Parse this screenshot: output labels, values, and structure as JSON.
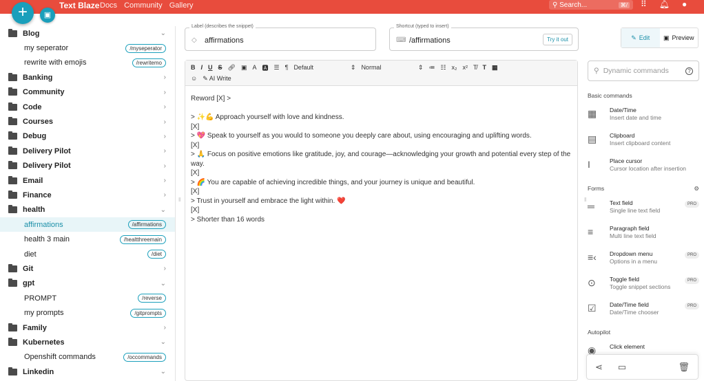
{
  "topbar": {
    "brand": "Text Blaze",
    "links": [
      "Docs",
      "Community",
      "Gallery"
    ],
    "search_placeholder": "Search...",
    "search_kbd": "⌘/"
  },
  "sidebar": {
    "rows": [
      {
        "type": "folder",
        "label": "Blog",
        "chev": "⌄"
      },
      {
        "type": "item",
        "label": "my seperator",
        "shortcut": "/myseperator"
      },
      {
        "type": "item",
        "label": "rewrite with emojis",
        "shortcut": "/rewritemo"
      },
      {
        "type": "folder",
        "label": "Banking",
        "chev": "›"
      },
      {
        "type": "folder",
        "label": "Community",
        "chev": "›"
      },
      {
        "type": "folder",
        "label": "Code",
        "chev": "›"
      },
      {
        "type": "folder",
        "label": "Courses",
        "chev": "›"
      },
      {
        "type": "folder",
        "label": "Debug",
        "chev": "›"
      },
      {
        "type": "folder",
        "label": "Delivery Pilot",
        "chev": "›"
      },
      {
        "type": "folder",
        "label": "Delivery Pilot",
        "chev": "›"
      },
      {
        "type": "folder",
        "label": "Email",
        "chev": "›"
      },
      {
        "type": "folder",
        "label": "Finance",
        "chev": "›"
      },
      {
        "type": "folder",
        "label": "health",
        "chev": "⌄"
      },
      {
        "type": "item",
        "label": "affirmations",
        "shortcut": "/affirmations",
        "active": true
      },
      {
        "type": "item",
        "label": "health 3 main",
        "shortcut": "/healtthreemain"
      },
      {
        "type": "item",
        "label": "diet",
        "shortcut": "/diet"
      },
      {
        "type": "folder",
        "label": "Git",
        "chev": "›"
      },
      {
        "type": "folder",
        "label": "gpt",
        "chev": "⌄"
      },
      {
        "type": "item",
        "label": "PROMPT",
        "shortcut": "/reverse"
      },
      {
        "type": "item",
        "label": "my prompts",
        "shortcut": "/gitprompts"
      },
      {
        "type": "folder",
        "label": "Family",
        "chev": "›"
      },
      {
        "type": "folder",
        "label": "Kubernetes",
        "chev": "⌄"
      },
      {
        "type": "item",
        "label": "Openshift commands",
        "shortcut": "/occommands"
      },
      {
        "type": "folder",
        "label": "Linkedin",
        "chev": "⌄"
      }
    ]
  },
  "snippet": {
    "label_caption": "Label (describes the snippet)",
    "label_value": "affirmations",
    "shortcut_caption": "Shortcut (typed to insert)",
    "shortcut_value": "/affirmations",
    "try_label": "Try it out"
  },
  "toolbar": {
    "font": "Default",
    "style": "Normal",
    "ai_write": "AI Write"
  },
  "editor_lines": [
    "Reword [X]  >",
    "",
    "> ✨💪 Approach yourself with love and kindness.",
    "[X]",
    "> 💖 Speak to yourself as you would to someone you deeply care about, using encouraging and uplifting words.",
    "[X]",
    "> 🙏 Focus on positive emotions like gratitude, joy, and courage—acknowledging your growth and potential every step of the way.",
    "[X]",
    "> 🌈 You are capable of achieving incredible things, and your journey is unique and beautiful.",
    "[X]",
    "> Trust in yourself and embrace the light within. ❤️",
    "[X]",
    "> Shorter than 16 words"
  ],
  "right": {
    "edit_label": "Edit",
    "preview_label": "Preview",
    "dyn_placeholder": "Dynamic commands",
    "basic_title": "Basic commands",
    "basic": [
      {
        "icon": "calendar-icon",
        "glyph": "▦",
        "title": "Date/Time",
        "desc": "Insert date and time"
      },
      {
        "icon": "clipboard-icon",
        "glyph": "▤",
        "title": "Clipboard",
        "desc": "Insert clipboard content"
      },
      {
        "icon": "cursor-icon",
        "glyph": "I",
        "title": "Place cursor",
        "desc": "Cursor location after insertion"
      }
    ],
    "forms_title": "Forms",
    "forms": [
      {
        "icon": "text-field-icon",
        "glyph": "═",
        "title": "Text field",
        "desc": "Single line text field",
        "pro": "PRO"
      },
      {
        "icon": "paragraph-field-icon",
        "glyph": "≡",
        "title": "Paragraph field",
        "desc": "Multi line text field",
        "pro": ""
      },
      {
        "icon": "dropdown-icon",
        "glyph": "≡‹",
        "title": "Dropdown menu",
        "desc": "Options in a menu",
        "pro": "PRO"
      },
      {
        "icon": "toggle-icon",
        "glyph": "⊙",
        "title": "Toggle field",
        "desc": "Toggle snippet sections",
        "pro": "PRO"
      },
      {
        "icon": "datetime-field-icon",
        "glyph": "☑",
        "title": "Date/Time field",
        "desc": "Date/Time chooser",
        "pro": "PRO"
      }
    ],
    "autopilot_title": "Autopilot",
    "autopilot_first": "Click element"
  }
}
